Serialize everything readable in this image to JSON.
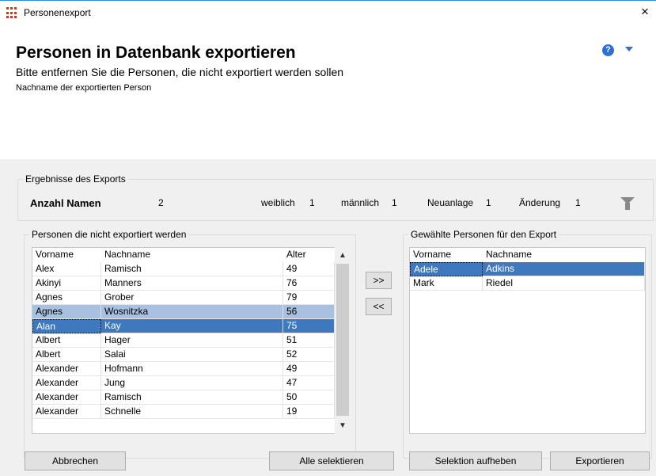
{
  "window": {
    "title": "Personenexport",
    "close": "×"
  },
  "header": {
    "title": "Personen in Datenbank exportieren",
    "subtitle": "Bitte entfernen Sie die Personen, die nicht exportiert werden sollen",
    "description": "Nachname der exportierten Person",
    "help_icon": "?"
  },
  "results": {
    "legend": "Ergebnisse des Exports",
    "count_label": "Anzahl Namen",
    "count_value": "2",
    "female_label": "weiblich",
    "female_value": "1",
    "male_label": "männlich",
    "male_value": "1",
    "new_label": "Neuanlage",
    "new_value": "1",
    "change_label": "Änderung",
    "change_value": "1"
  },
  "left_list": {
    "legend": "Personen die nicht exportiert werden",
    "columns": [
      "Vorname",
      "Nachname",
      "Alter"
    ],
    "rows": [
      {
        "first": "Alex",
        "last": "Ramisch",
        "age": "49",
        "state": ""
      },
      {
        "first": "Akinyi",
        "last": "Manners",
        "age": "76",
        "state": ""
      },
      {
        "first": "Agnes",
        "last": "Grober",
        "age": "79",
        "state": ""
      },
      {
        "first": "Agnes",
        "last": "Wosnitzka",
        "age": "56",
        "state": "sel-light"
      },
      {
        "first": "Alan",
        "last": "Kay",
        "age": "75",
        "state": "sel-dark"
      },
      {
        "first": "Albert",
        "last": "Hager",
        "age": "51",
        "state": ""
      },
      {
        "first": "Albert",
        "last": "Salai",
        "age": "52",
        "state": ""
      },
      {
        "first": "Alexander",
        "last": "Hofmann",
        "age": "49",
        "state": ""
      },
      {
        "first": "Alexander",
        "last": "Jung",
        "age": "47",
        "state": ""
      },
      {
        "first": "Alexander",
        "last": "Ramisch",
        "age": "50",
        "state": ""
      },
      {
        "first": "Alexander",
        "last": "Schnelle",
        "age": "19",
        "state": ""
      }
    ],
    "scroll_up": "▲",
    "scroll_down": "▼"
  },
  "right_list": {
    "legend": "Gewählte Personen für den Export",
    "columns": [
      "Vorname",
      "Nachname"
    ],
    "rows": [
      {
        "first": "Adele",
        "last": "Adkins",
        "state": "sel-dark"
      },
      {
        "first": "Mark",
        "last": "Riedel",
        "state": ""
      }
    ]
  },
  "buttons": {
    "add": ">>",
    "remove": "<<",
    "cancel": "Abbrechen",
    "select_all": "Alle selektieren",
    "clear_selection": "Selektion aufheben",
    "export": "Exportieren"
  },
  "icons": {
    "app": "grid-icon",
    "help": "help-icon",
    "filter": "funnel-icon"
  },
  "colors": {
    "selection_dark": "#3e78be",
    "selection_light": "#a9c1e0",
    "app_icon": "#d9311c"
  }
}
